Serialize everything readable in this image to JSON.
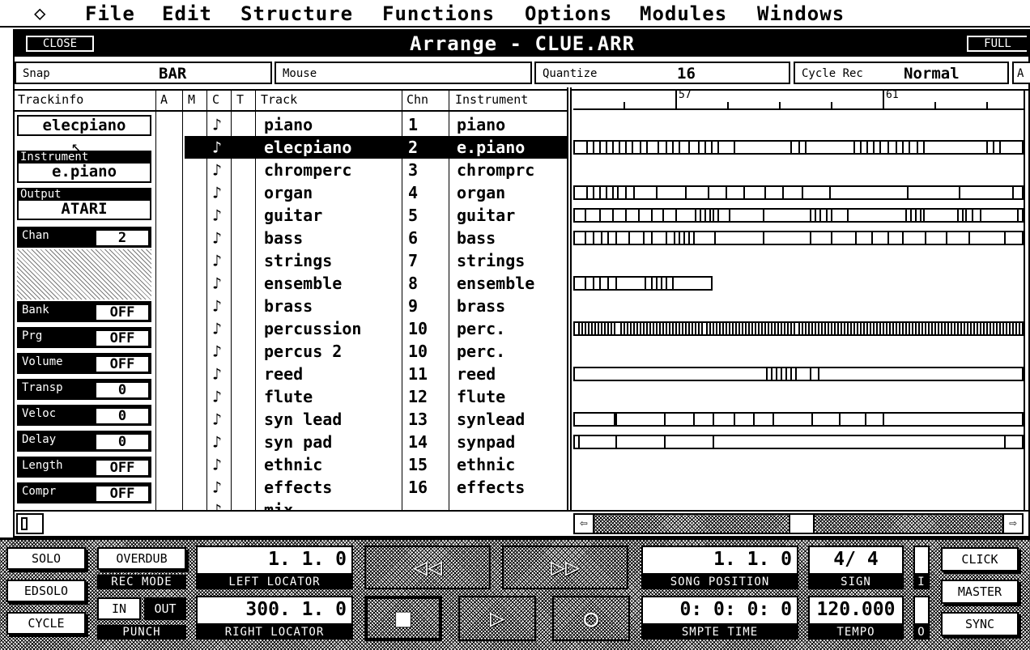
{
  "menu": {
    "apple": "◇",
    "items": [
      "File",
      "Edit",
      "Structure",
      "Functions",
      "Options",
      "Modules",
      "Windows"
    ]
  },
  "window": {
    "title": "Arrange - CLUE.ARR",
    "close_label": "CLOSE",
    "full_label": "FULL"
  },
  "infobar": {
    "snap_label": "Snap",
    "snap_value": "BAR",
    "mouse_label": "Mouse",
    "quantize_label": "Quantize",
    "quantize_value": "16",
    "cycle_label": "Cycle Rec",
    "cycle_value": "Normal",
    "extra_label": "A"
  },
  "headers": {
    "trackinfo": "Trackinfo",
    "a": "A",
    "m": "M",
    "c": "C",
    "t": "T",
    "track": "Track",
    "chn": "Chn",
    "instrument": "Instrument"
  },
  "ruler": {
    "bar1": "57",
    "bar2": "61"
  },
  "trackinfo": {
    "name": "elecpiano",
    "instrument_label": "Instrument",
    "instrument_value": "e.piano",
    "output_label": "Output",
    "output_value": "ATARI",
    "chan_label": "Chan",
    "chan_value": "2",
    "params": [
      {
        "label": "Bank",
        "value": "OFF"
      },
      {
        "label": "Prg",
        "value": "OFF"
      },
      {
        "label": "Volume",
        "value": "OFF"
      },
      {
        "label": "Transp",
        "value": "0"
      },
      {
        "label": "Veloc",
        "value": "0"
      },
      {
        "label": "Delay",
        "value": "0"
      },
      {
        "label": "Length",
        "value": "OFF"
      },
      {
        "label": "Compr",
        "value": "OFF"
      }
    ]
  },
  "tracks": [
    {
      "name": "piano",
      "chn": "1",
      "instrument": "piano"
    },
    {
      "name": "elecpiano",
      "chn": "2",
      "instrument": "e.piano",
      "selected": true
    },
    {
      "name": "chromperc",
      "chn": "3",
      "instrument": "chromprc"
    },
    {
      "name": "organ",
      "chn": "4",
      "instrument": "organ"
    },
    {
      "name": "guitar",
      "chn": "5",
      "instrument": "guitar"
    },
    {
      "name": "bass",
      "chn": "6",
      "instrument": "bass"
    },
    {
      "name": "strings",
      "chn": "7",
      "instrument": "strings"
    },
    {
      "name": "ensemble",
      "chn": "8",
      "instrument": "ensemble"
    },
    {
      "name": "brass",
      "chn": "9",
      "instrument": "brass"
    },
    {
      "name": "percussion",
      "chn": "10",
      "instrument": "perc."
    },
    {
      "name": "percus 2",
      "chn": "10",
      "instrument": "perc."
    },
    {
      "name": "reed",
      "chn": "11",
      "instrument": "reed"
    },
    {
      "name": "flute",
      "chn": "12",
      "instrument": "flute"
    },
    {
      "name": "syn lead",
      "chn": "13",
      "instrument": "synlead"
    },
    {
      "name": "syn pad",
      "chn": "14",
      "instrument": "synpad"
    },
    {
      "name": "ethnic",
      "chn": "15",
      "instrument": "ethnic"
    },
    {
      "name": "effects",
      "chn": "16",
      "instrument": "effects"
    },
    {
      "name": "mix",
      "chn": "",
      "instrument": ""
    }
  ],
  "transport": {
    "solo": "SOLO",
    "edsolo": "EDSOLO",
    "cycle": "CYCLE",
    "overdub": "OVERDUB",
    "rec_mode": "REC MODE",
    "punch_in": "IN",
    "punch_out": "OUT",
    "punch": "PUNCH",
    "left_locator_value": "1. 1.   0",
    "left_locator": "LEFT LOCATOR",
    "right_locator_value": "300. 1.   0",
    "right_locator": "RIGHT LOCATOR",
    "song_position_value": "1. 1.   0",
    "song_position": "SONG POSITION",
    "smpte_value": "0: 0: 0: 0",
    "smpte": "SMPTE TIME",
    "sign_value": "4/ 4",
    "sign": "SIGN",
    "tempo_value": "120.000",
    "tempo": "TEMPO",
    "i_label": "I",
    "o_label": "O",
    "click": "CLICK",
    "master": "MASTER",
    "sync": "SYNC"
  }
}
